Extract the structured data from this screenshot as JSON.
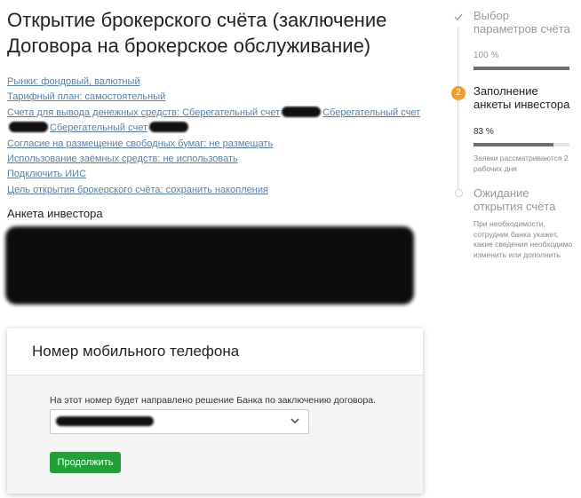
{
  "page": {
    "title": "Открытие брокерского счёта (заключение Договора на брокерское обслуживание)"
  },
  "params": {
    "markets": "Рынки: фондовый, валютный",
    "tariff": "Тарифный план: самостоятельный",
    "account_line1_pre": "Счета для вывода денежных средств: Сберегательный счет",
    "account_line1_post": "Сберегательный счет",
    "account_line2_post": "Сберегательный счет",
    "account_line3": "Сберегательный счет",
    "securities": "Согласие на размещение свободных бумаг: не размещать",
    "borrowed": "Использование заёмных средств: не использовать",
    "iis": "Подключить ИИС",
    "goal": "Цель открытия брокерского счёта: сохранить накопления"
  },
  "investor": {
    "heading": "Анкета инвестора"
  },
  "phone_card": {
    "heading": "Номер мобильного телефона",
    "note": "На этот номер будет направлено решение Банка по заключению договора.",
    "continue_label": "Продолжить"
  },
  "steps": [
    {
      "title": "Выбор параметров счёта",
      "progress_text": "100 %",
      "progress": 1.0,
      "state": "done"
    },
    {
      "number": "2",
      "title": "Заполнение анкеты инвестора",
      "progress_text": "83 %",
      "progress": 0.83,
      "state": "active",
      "note": "Заявки рассматриваются 2 рабочих дня"
    },
    {
      "title": "Ожидание открытия счёта",
      "state": "pending",
      "note": "При необходимости, сотрудник банка укажет, какие сведения необходимо изменить или дополнить"
    }
  ],
  "colors": {
    "accent_green": "#21a038",
    "link": "#5a7fa3",
    "step_active": "#f39c2b"
  }
}
